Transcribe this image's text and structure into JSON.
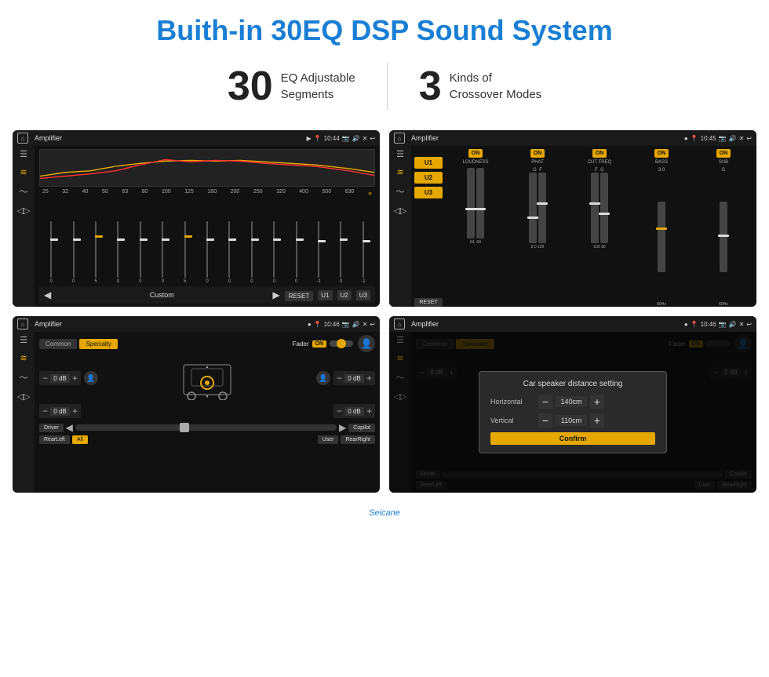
{
  "page": {
    "title": "Buith-in 30EQ DSP Sound System"
  },
  "stats": {
    "eq_number": "30",
    "eq_label_line1": "EQ Adjustable",
    "eq_label_line2": "Segments",
    "crossover_number": "3",
    "crossover_label_line1": "Kinds of",
    "crossover_label_line2": "Crossover Modes"
  },
  "screen1": {
    "app_title": "Amplifier",
    "time": "10:44",
    "freq_labels": [
      "25",
      "32",
      "40",
      "50",
      "63",
      "80",
      "100",
      "125",
      "160",
      "200",
      "250",
      "320",
      "400",
      "500",
      "630"
    ],
    "preset": "Custom",
    "buttons": {
      "reset": "RESET",
      "u1": "U1",
      "u2": "U2",
      "u3": "U3"
    }
  },
  "screen2": {
    "app_title": "Amplifier",
    "time": "10:45",
    "u_buttons": [
      "U1",
      "U2",
      "U3"
    ],
    "reset_label": "RESET",
    "columns": [
      {
        "header_on": "ON",
        "label": "LOUDNESS"
      },
      {
        "header_on": "ON",
        "label": "PHAT"
      },
      {
        "header_on": "ON",
        "label": "CUT FREQ"
      },
      {
        "header_on": "ON",
        "label": "BASS"
      },
      {
        "header_on": "ON",
        "label": "SUB"
      }
    ]
  },
  "screen3": {
    "app_title": "Amplifier",
    "time": "10:46",
    "tabs": [
      "Common",
      "Specialty"
    ],
    "active_tab": "Specialty",
    "fader_label": "Fader",
    "fader_on": "ON",
    "db_values": [
      "0 dB",
      "0 dB",
      "0 dB",
      "0 dB"
    ],
    "speaker_buttons": {
      "driver": "Driver",
      "rear_left": "RearLeft",
      "all": "All",
      "user": "User",
      "rear_right": "RearRight",
      "copilot": "Copilot"
    },
    "person_icon": "👤"
  },
  "screen4": {
    "app_title": "Amplifier",
    "time": "10:46",
    "tabs": [
      "Common",
      "Specialty"
    ],
    "active_tab": "Specialty",
    "dialog": {
      "title": "Car speaker distance setting",
      "horizontal_label": "Horizontal",
      "horizontal_value": "140cm",
      "vertical_label": "Vertical",
      "vertical_value": "110cm",
      "confirm_label": "Confirm"
    },
    "db_values": [
      "0 dB",
      "0 dB"
    ],
    "speaker_buttons": {
      "driver": "Driver",
      "rear_left": "RearLeft",
      "user": "User",
      "rear_right": "RearRight",
      "copilot": "Copilot"
    }
  },
  "watermark": {
    "brand": "Seicane"
  }
}
